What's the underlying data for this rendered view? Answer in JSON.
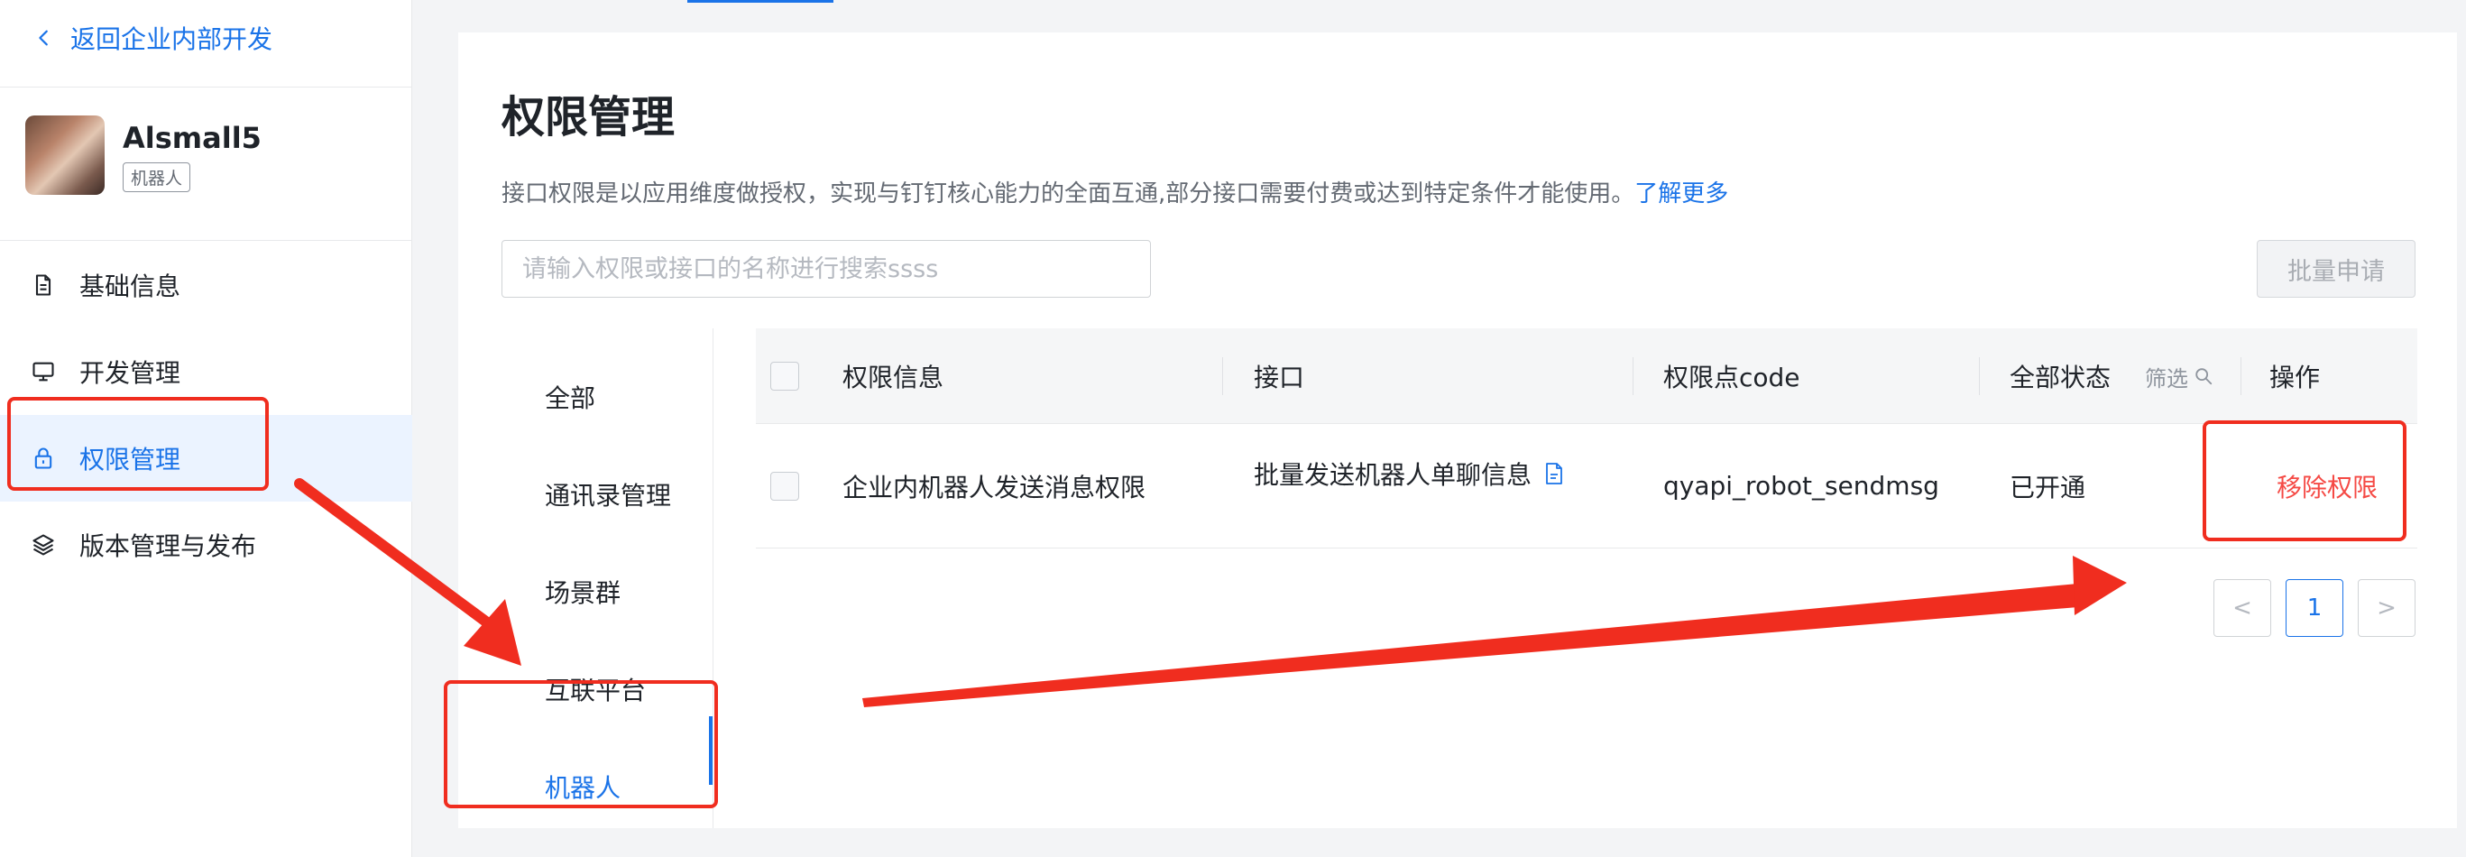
{
  "sidebar": {
    "back_label": "返回企业内部开发",
    "app": {
      "name": "Alsmall5",
      "badge": "机器人"
    },
    "nav": [
      {
        "label": "基础信息",
        "icon": "document-icon"
      },
      {
        "label": "开发管理",
        "icon": "monitor-icon"
      },
      {
        "label": "权限管理",
        "icon": "lock-icon",
        "active": true
      },
      {
        "label": "版本管理与发布",
        "icon": "layers-icon"
      }
    ]
  },
  "main": {
    "title": "权限管理",
    "description": "接口权限是以应用维度做授权，实现与钉钉核心能力的全面互通,部分接口需要付费或达到特定条件才能使用。",
    "learn_more": "了解更多",
    "search_placeholder": "请输入权限或接口的名称进行搜索ssss",
    "batch_apply": "批量申请",
    "categories": [
      "全部",
      "通讯录管理",
      "场景群",
      "互联平台",
      "机器人"
    ],
    "active_category": "机器人",
    "table": {
      "headers": {
        "info": "权限信息",
        "api": "接口",
        "code": "权限点code",
        "status": "全部状态",
        "filter": "筛选",
        "action": "操作"
      },
      "rows": [
        {
          "info": "企业内机器人发送消息权限",
          "api": "批量发送机器人单聊信息",
          "code": "qyapi_robot_sendmsg",
          "status": "已开通",
          "action": "移除权限"
        }
      ]
    },
    "pagination": {
      "current": "1",
      "prev": "<",
      "next": ">"
    }
  },
  "colors": {
    "accent": "#1a73e8",
    "danger": "#f54a45",
    "annotation": "#f02d1f"
  }
}
